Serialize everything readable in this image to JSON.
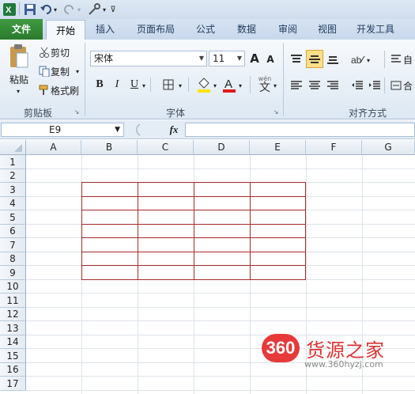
{
  "tabs": {
    "file": "文件",
    "home": "开始",
    "insert": "插入",
    "page_layout": "页面布局",
    "formulas": "公式",
    "data": "数据",
    "review": "审阅",
    "view": "视图",
    "developer": "开发工具"
  },
  "clipboard": {
    "paste": "粘贴",
    "cut": "剪切",
    "copy": "复制",
    "format_painter": "格式刷",
    "label": "剪贴板"
  },
  "font": {
    "name": "宋体",
    "size": "11",
    "bold": "B",
    "italic": "I",
    "underline": "U",
    "grow": "A",
    "shrink": "A",
    "label": "字体",
    "wen": "wén"
  },
  "alignment": {
    "label": "对齐方式",
    "auto": "自",
    "merge": "合"
  },
  "formula_bar": {
    "name_box": "E9",
    "fx": "fx"
  },
  "sheet": {
    "columns": [
      "A",
      "B",
      "C",
      "D",
      "E",
      "F",
      "G"
    ],
    "rows": [
      "1",
      "2",
      "3",
      "4",
      "5",
      "6",
      "7",
      "8",
      "9",
      "10",
      "11",
      "12",
      "13",
      "14",
      "15",
      "16",
      "17"
    ],
    "border_color": "#a52a2a"
  },
  "watermark": {
    "badge": "360",
    "title": "货源之家",
    "url": "www.360hyzj.com"
  }
}
